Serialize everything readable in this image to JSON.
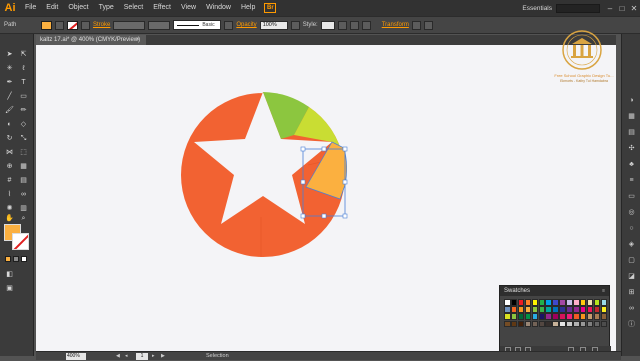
{
  "app": {
    "logo": "Ai",
    "bridge_label": "Br"
  },
  "menu": [
    "File",
    "Edit",
    "Object",
    "Type",
    "Select",
    "Effect",
    "View",
    "Window",
    "Help"
  ],
  "workspace": "Essentials",
  "window_buttons": {
    "minimize": "–",
    "maximize": "□",
    "close": "✕"
  },
  "control": {
    "object_type": "Path",
    "stroke_label": "Stroke",
    "brush_style": "Basic",
    "opacity_label": "Opacity",
    "opacity_value": "100%",
    "style_label": "Style:",
    "transform_label": "Transform",
    "fill_color": "#fbb040"
  },
  "document": {
    "tab_title": "kaltz 17.ai* @ 400% (CMYK/Preview)",
    "close": "×"
  },
  "status": {
    "zoom": "400%",
    "page": "1",
    "tool": "Selection"
  },
  "swatches_panel": {
    "title": "Swatches",
    "colors": [
      "#ffffff",
      "#000000",
      "#ed1c24",
      "#ff7f27",
      "#fff200",
      "#22b14c",
      "#00a2e8",
      "#3f48cc",
      "#a349a4",
      "#c8bfe7",
      "#ffaec9",
      "#ffc90e",
      "#efe4b0",
      "#b5e61d",
      "#99d9ea",
      "#7092be",
      "#f26522",
      "#f7941d",
      "#fbb040",
      "#8dc63f",
      "#39b54a",
      "#00a99d",
      "#0072bc",
      "#2e3192",
      "#662d91",
      "#92278f",
      "#ec008c",
      "#ed145b",
      "#c1272d",
      "#fcee21",
      "#d9e021",
      "#8cc63f",
      "#006837",
      "#009245",
      "#29abe2",
      "#1b1464",
      "#93278f",
      "#9e005d",
      "#d4145a",
      "#ed1e79",
      "#f15a24",
      "#f7931e",
      "#c69c6d",
      "#a67c52",
      "#8c6239",
      "#754c24",
      "#603813",
      "#42210b",
      "#998675",
      "#736357",
      "#534741",
      "#362f2d",
      "#c7b299",
      "#e6e6e6",
      "#cccccc",
      "#b3b3b3",
      "#999999",
      "#808080",
      "#666666",
      "#4d4d4d"
    ],
    "accent": "#f26522"
  },
  "watermark": {
    "org": "Free School Graphic Design Tu...",
    "author": "Ekmorts - Kathy Tul Hamdabra"
  },
  "artwork": {
    "circle_color": "#f26232",
    "green_color": "#8cc63f",
    "lime_color": "#c9dd33",
    "selected_fill": "#fbb040",
    "selection_color": "#4a7fd6",
    "background": "#f4f4f7"
  }
}
